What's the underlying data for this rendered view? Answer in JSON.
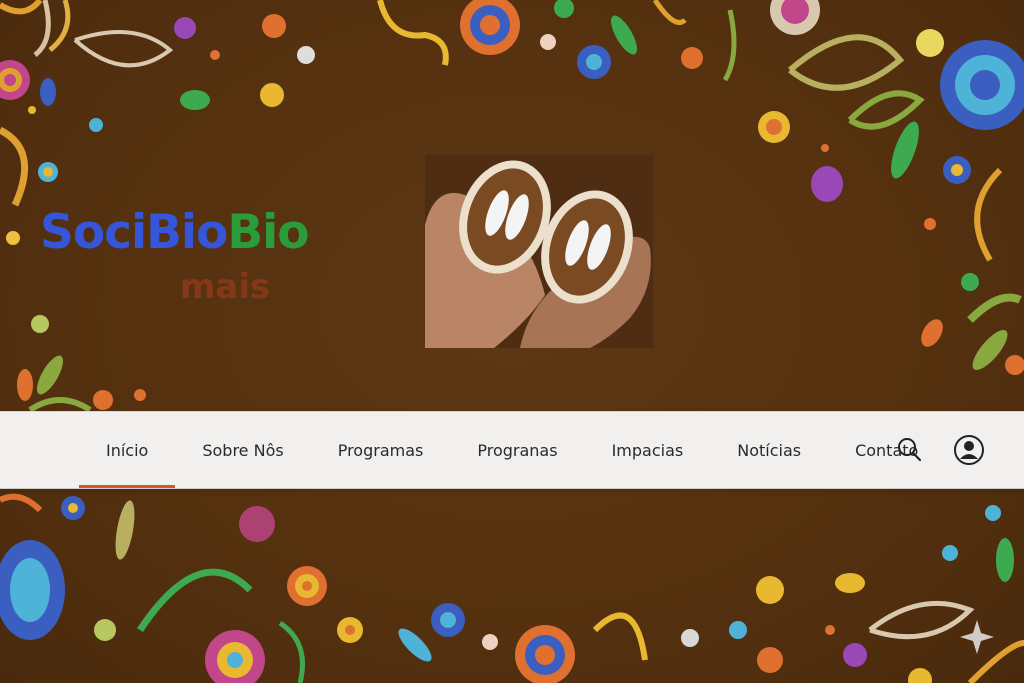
{
  "brand": {
    "name_part1": "SociBio",
    "name_part2": "Bio",
    "subtitle": "mais",
    "color_primary": "#3556d8",
    "color_secondary": "#2a9c3a",
    "color_sub": "#8b3a1a"
  },
  "hero": {
    "image": "hands-holding-opened-seed-pods"
  },
  "nav": {
    "items": [
      {
        "label": "Início",
        "active": true
      },
      {
        "label": "Sobre Nôs"
      },
      {
        "label": "Programas"
      },
      {
        "label": "Progranas"
      },
      {
        "label": "Impacias"
      },
      {
        "label": "Notícias"
      },
      {
        "label": "Contato"
      }
    ],
    "accent": "#d4572a",
    "background": "#f1f0ee"
  },
  "icons": [
    "search-icon",
    "user-icon",
    "sparkle-icon"
  ],
  "colors": {
    "background": "#5a3415"
  }
}
